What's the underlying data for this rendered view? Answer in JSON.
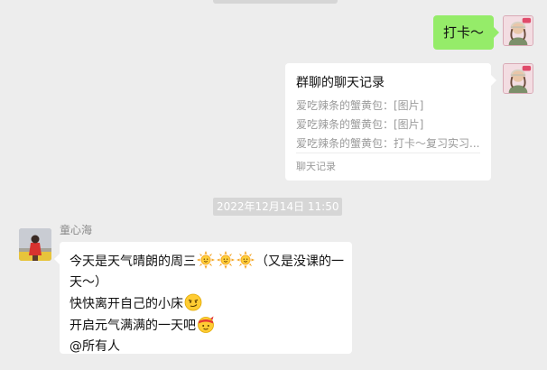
{
  "messages": {
    "outgoing_text": {
      "text": "打卡～"
    },
    "chat_record": {
      "title": "群聊的聊天记录",
      "lines": [
        "爱吃辣条的蟹黄包：[图片]",
        "爱吃辣条的蟹黄包：[图片]",
        "爱吃辣条的蟹黄包：打卡～复习实习..."
      ],
      "footer": "聊天记录"
    },
    "timestamp": "2022年12月14日 11:50",
    "incoming": {
      "sender": "童心海",
      "line1_text": "今天是天气晴朗的周三",
      "line1_suffix": "（又是没课的一天～）",
      "line2_text": "快快离开自己的小床",
      "line3_text": "开启元气满满的一天吧",
      "line4_text": "@所有人"
    }
  },
  "colors": {
    "background": "#ededed",
    "outgoing_bubble": "#95ec69",
    "incoming_bubble": "#ffffff",
    "timestamp_bg": "#d6d6d6",
    "secondary_text": "#9a9a9a"
  },
  "icons": {
    "sun": "sun-emoji-icon",
    "smirk": "smirk-emoji-icon",
    "cheer": "headband-emoji-icon"
  }
}
